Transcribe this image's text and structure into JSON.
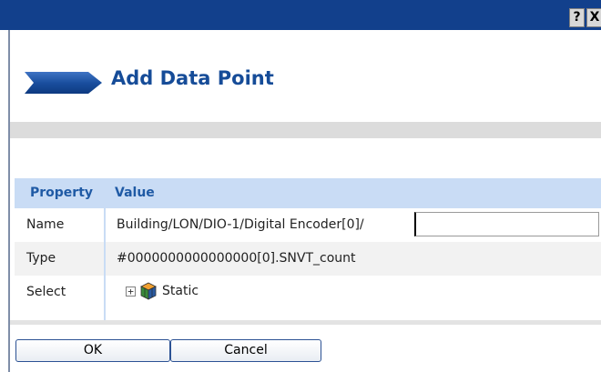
{
  "window": {
    "help_label": "?",
    "close_label": "X"
  },
  "dialog": {
    "title": "Add Data Point",
    "accent_color": "#164c98",
    "banner_icon": "chevron-banner-icon"
  },
  "table": {
    "headers": {
      "property": "Property",
      "value": "Value"
    },
    "rows": {
      "name": {
        "label": "Name",
        "value_prefix": "Building/LON/DIO-1/Digital Encoder[0]/",
        "input_value": ""
      },
      "type": {
        "label": "Type",
        "value": "#0000000000000000[0].SNVT_count"
      },
      "select": {
        "label": "Select",
        "expander": "⊞",
        "node_icon": "cube-icon",
        "node_label": "Static"
      }
    }
  },
  "buttons": {
    "ok": "OK",
    "cancel": "Cancel"
  },
  "colors": {
    "titlebar": "#12408c",
    "header_row": "#c9dcf5",
    "header_text": "#1f5aa5"
  }
}
